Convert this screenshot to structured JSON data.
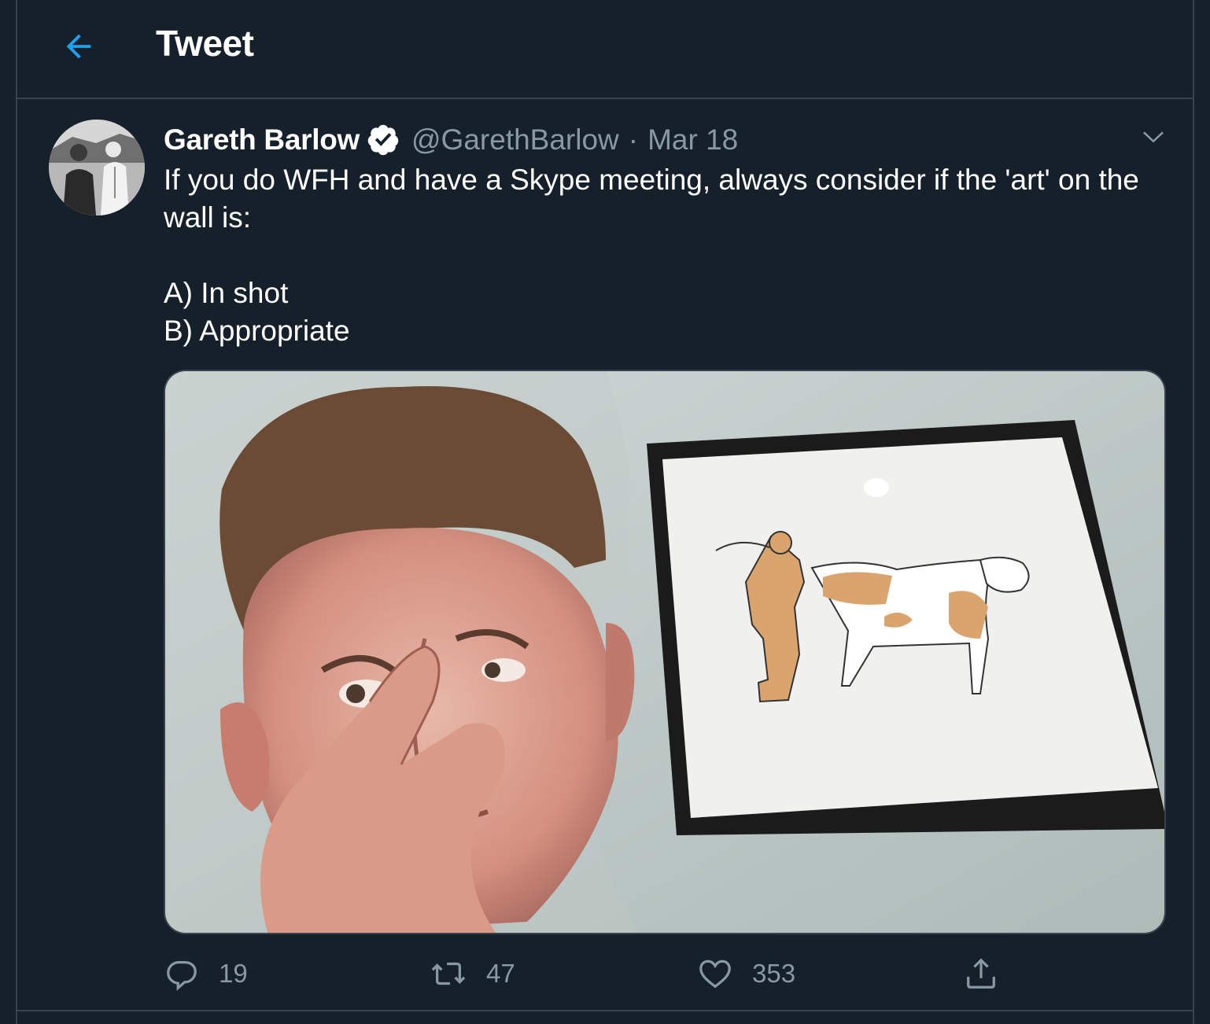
{
  "header": {
    "title": "Tweet",
    "back_icon": "arrow-left-icon"
  },
  "tweet": {
    "author": {
      "name": "Gareth Barlow",
      "handle": "@GarethBarlow",
      "verified": true
    },
    "separator": "·",
    "date": "Mar 18",
    "text_lines": [
      "If you do WFH and have a Skype meeting, always consider if the 'art' on the wall is:",
      "",
      "A) In shot",
      "B) Appropriate"
    ],
    "actions": {
      "reply": {
        "icon": "reply-bubble-icon",
        "count": "19"
      },
      "retweet": {
        "icon": "retweet-icon",
        "count": "47"
      },
      "like": {
        "icon": "heart-icon",
        "count": "353"
      },
      "share": {
        "icon": "share-upload-icon"
      }
    }
  },
  "colors": {
    "background": "#15202b",
    "border": "#38444d",
    "accent": "#1da1f2",
    "secondary_text": "#8899a6",
    "primary_text": "#ffffff"
  }
}
